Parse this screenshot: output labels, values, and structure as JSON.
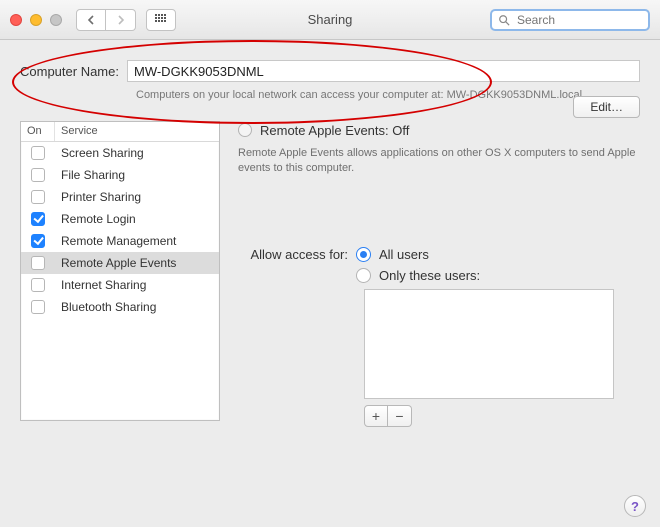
{
  "window": {
    "title": "Sharing"
  },
  "search": {
    "placeholder": "Search"
  },
  "computer_name": {
    "label": "Computer Name:",
    "value": "MW-DGKK9053DNML",
    "subtext": "Computers on your local network can access your computer at: MW-DGKK9053DNML.local",
    "edit_label": "Edit…"
  },
  "services": {
    "header_on": "On",
    "header_service": "Service",
    "items": [
      {
        "label": "Screen Sharing",
        "on": false,
        "selected": false
      },
      {
        "label": "File Sharing",
        "on": false,
        "selected": false
      },
      {
        "label": "Printer Sharing",
        "on": false,
        "selected": false
      },
      {
        "label": "Remote Login",
        "on": true,
        "selected": false
      },
      {
        "label": "Remote Management",
        "on": true,
        "selected": false
      },
      {
        "label": "Remote Apple Events",
        "on": false,
        "selected": true
      },
      {
        "label": "Internet Sharing",
        "on": false,
        "selected": false
      },
      {
        "label": "Bluetooth Sharing",
        "on": false,
        "selected": false
      }
    ]
  },
  "detail": {
    "status_title": "Remote Apple Events: Off",
    "status_desc": "Remote Apple Events allows applications on other OS X computers to send Apple events to this computer.",
    "access_label": "Allow access for:",
    "opt_all": "All users",
    "opt_only": "Only these users:"
  }
}
